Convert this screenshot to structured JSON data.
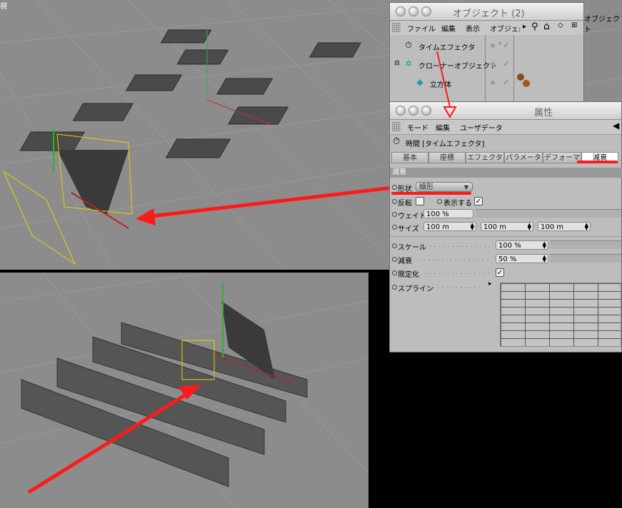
{
  "viewport": {
    "label": "視"
  },
  "objects_window": {
    "title": "オブジェクト (2)",
    "menu": [
      "ファイル",
      "編集",
      "表示",
      "オブジェ:"
    ],
    "rows": [
      {
        "name": "タイムエフェクタ",
        "icon": "stopwatch-icon"
      },
      {
        "name": "クローナーオブジェクト",
        "icon": "cloner-icon"
      },
      {
        "name": "立方体",
        "icon": "cube-icon"
      }
    ],
    "behind_label": "オブジェクト"
  },
  "attributes_window": {
    "title": "属性",
    "menu": [
      "モード",
      "編集",
      "ユーザデータ"
    ],
    "object_title": "時間 [タイムエフェクタ]",
    "tabs": [
      "基本",
      "座標",
      "エフェクタ",
      "パラメータ",
      "デフォーマ",
      "減衰"
    ],
    "active_tab": "減衰",
    "section": "減衰",
    "params": {
      "shape_label": "形状",
      "shape_value": "線形",
      "invert_label": "反転",
      "show_label": "表示する",
      "weight_label": "ウェイト",
      "weight_value": "100 %",
      "size_label": "サイズ",
      "size_x": "100 m",
      "size_y": "100 m",
      "size_z": "100 m",
      "scale_label": "スケール",
      "scale_value": "100 %",
      "falloff_label": "減衰",
      "falloff_value": "50 %",
      "clamp_label": "限定化",
      "spline_label": "スプライン"
    }
  },
  "colors": {
    "annotation": "#ff1a1a",
    "panel": "#bdbdbd",
    "viewport": "#8c8c8c"
  }
}
